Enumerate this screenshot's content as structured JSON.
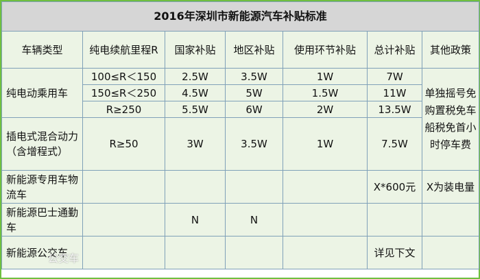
{
  "title": "2016年深圳市新能源汽车补贴标准",
  "headers": [
    "车辆类型",
    "纯电续航里程R",
    "国家补贴",
    "地区补贴",
    "使用环节补贴",
    "总计补贴",
    "其他政策"
  ],
  "rows": {
    "pure_ev": {
      "type": "纯电动乘用车",
      "ranges": [
        "100≤R＜150",
        "150≤R＜250",
        "R≥250"
      ],
      "national": [
        "2.5W",
        "4.5W",
        "5.5W"
      ],
      "regional": [
        "3.5W",
        "5W",
        "6W"
      ],
      "usage": [
        "1W",
        "1.5W",
        "2W"
      ],
      "total": [
        "7W",
        "11W",
        "13.5W"
      ]
    },
    "phev": {
      "type": "插电式混合动力（含增程式）",
      "range": "R≥50",
      "national": "3W",
      "regional": "3.5W",
      "usage": "1W",
      "total": "7.5W"
    },
    "special": {
      "type": "新能源专用车物流车",
      "total": "X*600元",
      "other": "X为装电量"
    },
    "bus": {
      "type": "新能源巴士通勤车",
      "national": "N",
      "regional": "N"
    },
    "public_bus": {
      "type": "新能源公交车",
      "total": "详见下文"
    }
  },
  "other_policy": "单独摇号免购置税免车船税免首小时停车费",
  "watermark": "公交车"
}
